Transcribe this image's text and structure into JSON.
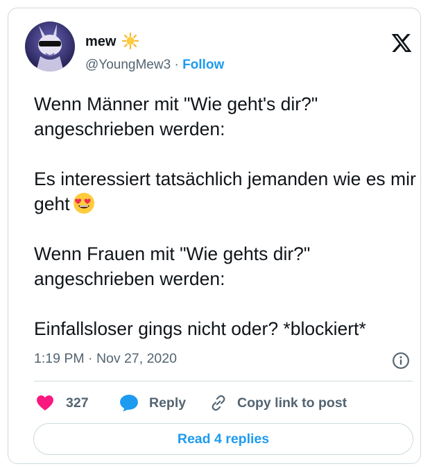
{
  "author": {
    "display_name": "mew",
    "name_emoji": "sun-emoji",
    "handle": "@YoungMew3",
    "separator": "·",
    "follow_label": "Follow",
    "avatar": "avatar-image"
  },
  "brand_logo": "x-logo-icon",
  "tweet": {
    "paragraphs": [
      "Wenn Männer mit \"Wie geht's dir?\" angeschrieben werden:",
      "Es interessiert tatsächlich jemanden wie es mir geht",
      "Wenn Frauen mit \"Wie gehts dir?\" angeschrieben werden:",
      "Einfallsloser gings nicht oder? *blockiert*"
    ],
    "inline_emoji": "heart-eyes-emoji"
  },
  "meta": {
    "timestamp": "1:19 PM · Nov 27, 2020",
    "info_icon": "info-icon"
  },
  "actions": {
    "like_count": "327",
    "reply_label": "Reply",
    "copy_label": "Copy link to post"
  },
  "read_replies_label": "Read 4 replies",
  "colors": {
    "accent": "#1d9bf0",
    "like": "#f91880",
    "text_primary": "#0f1419",
    "text_secondary": "#536471",
    "border": "#cfd9de"
  }
}
